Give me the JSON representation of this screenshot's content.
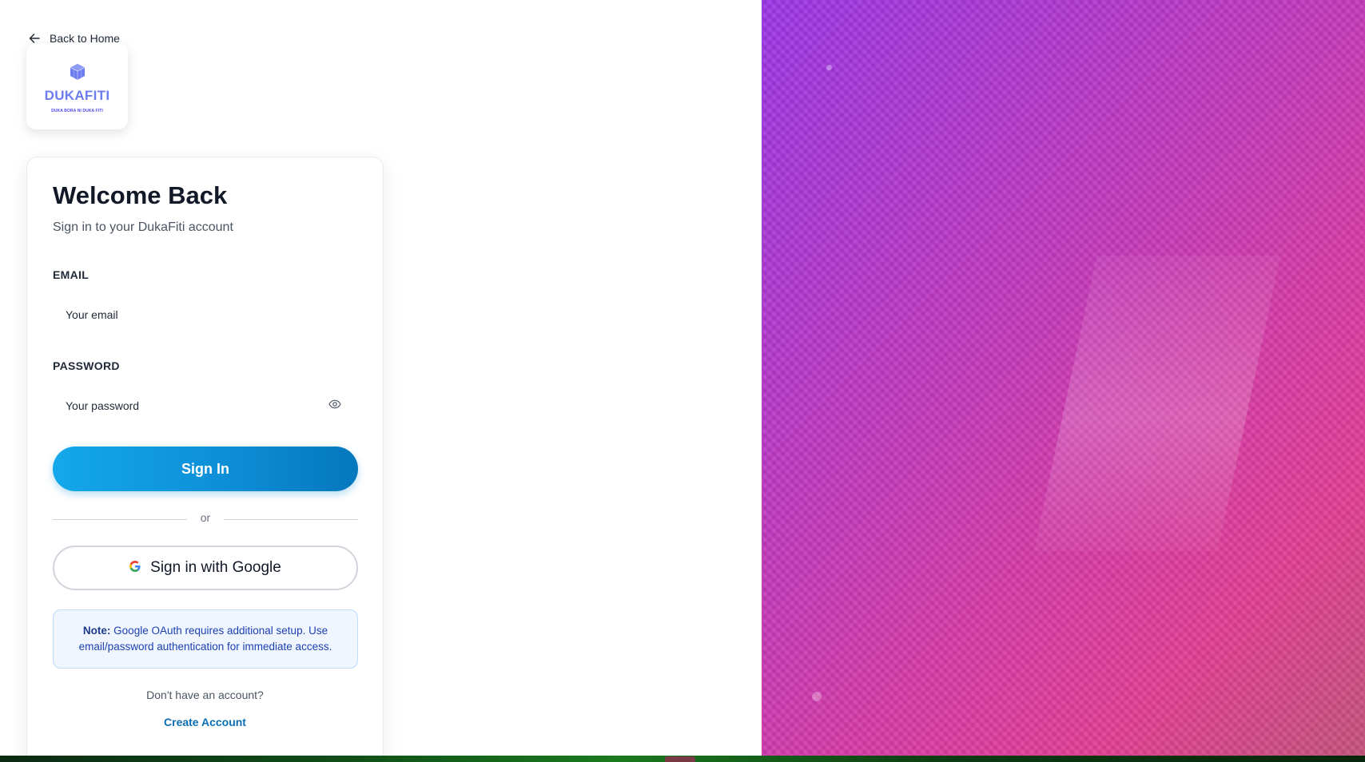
{
  "nav": {
    "back_label": "Back to Home"
  },
  "brand": {
    "name": "DUKAFITI",
    "tagline": "DUKA BORA NI DUKA FITI",
    "color": "#6d7df0"
  },
  "login": {
    "title": "Welcome Back",
    "subtitle": "Sign in to your DukaFiti account",
    "email_label": "EMAIL",
    "email_placeholder": "Your email",
    "password_label": "PASSWORD",
    "password_placeholder": "Your password",
    "password_toggle_icon": "eye-icon",
    "submit_label": "Sign In",
    "divider_text": "or",
    "google_label": "Sign in with Google",
    "note_prefix": "Note:",
    "note_text": "Google OAuth requires additional setup. Use email/password authentication for immediate access.",
    "no_account_text": "Don't have an account?",
    "create_account_label": "Create Account"
  },
  "colors": {
    "primary_button": "#0d8fd8",
    "link": "#0b6fb3",
    "note_bg": "#eff6ff",
    "hero_gradient_start": "#9a36e6",
    "hero_gradient_end": "#e23d93"
  }
}
